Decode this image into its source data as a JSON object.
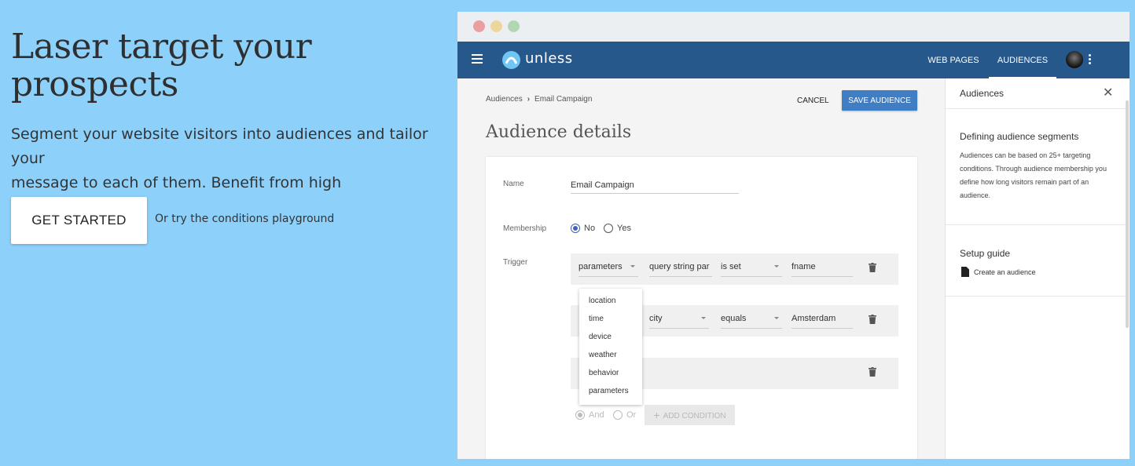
{
  "hero": {
    "title_line1": "Laser target your",
    "title_line2": "prospects",
    "subtitle_line1": "Segment your website visitors into audiences and tailor your",
    "subtitle_line2": "message to each of them. Benefit from high engagement!",
    "cta_label": "GET STARTED",
    "alt_link": "Or try the conditions playground"
  },
  "app": {
    "logo_text": "unless",
    "nav": {
      "web_pages": "WEB PAGES",
      "audiences": "AUDIENCES"
    },
    "breadcrumb": {
      "root": "Audiences",
      "current": "Email Campaign"
    },
    "actions": {
      "cancel": "CANCEL",
      "save": "SAVE AUDIENCE"
    },
    "page_title": "Audience details",
    "form": {
      "name_label": "Name",
      "name_value": "Email Campaign",
      "membership_label": "Membership",
      "membership_no": "No",
      "membership_yes": "Yes",
      "membership_selected": "No",
      "trigger_label": "Trigger",
      "conditions": [
        {
          "type": "parameters",
          "field": "query string par",
          "operator": "is set",
          "value": "fname"
        },
        {
          "type": "",
          "field": "city",
          "operator": "equals",
          "value": "Amsterdam"
        },
        {
          "type": "",
          "field": "",
          "operator": "",
          "value": ""
        }
      ],
      "dropdown_options": [
        "location",
        "time",
        "device",
        "weather",
        "behavior",
        "parameters"
      ],
      "logic_and": "And",
      "logic_or": "Or",
      "logic_selected": "And",
      "add_condition": "ADD CONDITION"
    }
  },
  "side_panel": {
    "title": "Audiences",
    "section1_title": "Defining audience segments",
    "section1_body": "Audiences can be based on 25+ targeting conditions. Through audience membership you define how long visitors remain part of an audience.",
    "section2_title": "Setup guide",
    "guide_link": "Create an audience"
  },
  "colors": {
    "background": "#8dd1fb",
    "appbar": "#26588b",
    "primary_button": "#3f7ec5",
    "radio_accent": "#3f63b5"
  }
}
